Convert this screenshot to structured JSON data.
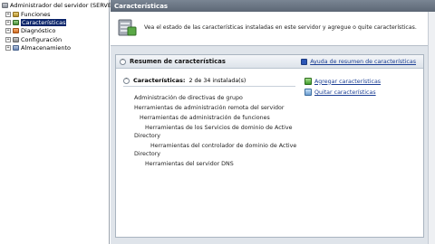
{
  "tree": {
    "root_label": "Administrador del servidor (SERVER",
    "items": [
      {
        "label": "Funciones",
        "expander": "+",
        "icon": "roles-icon"
      },
      {
        "label": "Características",
        "expander": "+",
        "icon": "features-icon",
        "selected": true
      },
      {
        "label": "Diagnóstico",
        "expander": "+",
        "icon": "diagnostics-icon"
      },
      {
        "label": "Configuración",
        "expander": "+",
        "icon": "configuration-icon"
      },
      {
        "label": "Almacenamiento",
        "expander": "+",
        "icon": "storage-icon"
      }
    ]
  },
  "header": {
    "title": "Características"
  },
  "intro": {
    "text": "Vea el estado de las características instaladas en este servidor y agregue o quite características."
  },
  "summary": {
    "title": "Resumen de características",
    "help_link": "Ayuda de resumen de características",
    "sub_label": "Características:",
    "count_text": "2 de 34 instalada(s)",
    "actions": [
      {
        "label": "Agregar características",
        "icon": "add-features-icon"
      },
      {
        "label": "Quitar características",
        "icon": "remove-features-icon"
      }
    ],
    "features": [
      "Administración de directivas de grupo",
      "Herramientas de administración remota del servidor",
      "Herramientas de administración de funciones",
      "Herramientas de los Servicios de dominio de Active",
      "Directory",
      "Herramientas del controlador de dominio de Active",
      "Directory",
      "Herramientas del servidor DNS"
    ]
  },
  "colors": {
    "header_bar": "#5c6775",
    "link": "#1c3f94",
    "selection": "#0a246a",
    "pane_background": "#dfe4ea"
  }
}
